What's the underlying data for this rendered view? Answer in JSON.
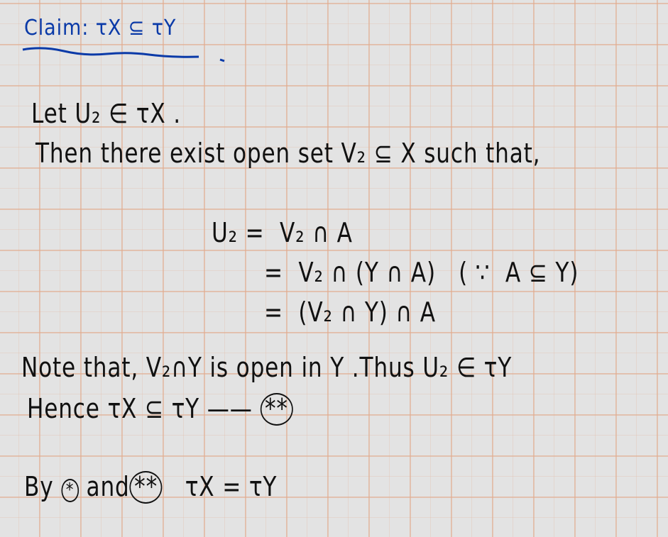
{
  "claim": {
    "label": "Claim:",
    "statement": "τX ⊆ τY",
    "color": "#0a3aa8"
  },
  "proof": {
    "line1": "Let U₂ ∈ τX .",
    "line2": "Then there exist open set V₂ ⊆ X such that,",
    "eq1": "U₂ =  V₂ ∩ A",
    "eq2": "=  V₂ ∩ (Y ∩ A)   ( ∵  A ⊆ Y)",
    "eq3": "=  (V₂ ∩ Y) ∩ A",
    "line3": "Note that, V₂∩Y is open in Y .Thus U₂ ∈ τY",
    "line4": "Hence τX ⊆ τY ——",
    "mark2": "**",
    "line5_a": "By",
    "mark1": "*",
    "line5_b": "and",
    "line5_c": "τX = τY"
  }
}
